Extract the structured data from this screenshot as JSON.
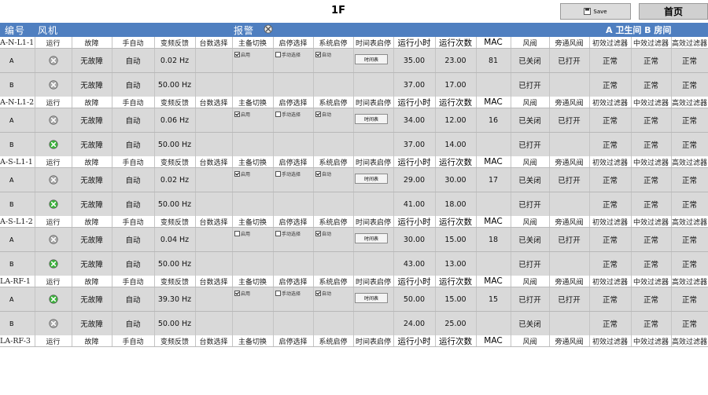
{
  "app": {
    "floor_title": "1F",
    "save_label": "Save",
    "home_label": "首页"
  },
  "header": {
    "number_label": "编号",
    "fan_label": "风机",
    "alarm_label": "报警",
    "room_label": "A 卫生间 B 房间"
  },
  "columns": {
    "run": "运行",
    "fault": "故障",
    "mode": "手自动",
    "freq": "变频反馈",
    "count_select": "台数选择",
    "standby_switch": "主备切换",
    "start_select": "启停选择",
    "system_start": "系统启停",
    "schedule": "时间表启停",
    "run_hours": "运行小时",
    "run_count": "运行次数",
    "mac": "MAC",
    "damper": "风阀",
    "bypass_damper": "旁通风阀",
    "primary_filter": "初效过滤器",
    "medium_filter": "中效过滤器",
    "hepa_filter": "高效过滤器"
  },
  "check": {
    "enable": "启用",
    "manual": "手动选择",
    "auto": "自动"
  },
  "icons": {
    "run_on_color": "#3bb53b",
    "run_off_color": "#a8a8a8",
    "alarm_icon": "gear-alarm-icon"
  },
  "units": [
    {
      "id": "A-N-L1-1",
      "mac": "81",
      "schedule_btn": "时间表",
      "rows": [
        {
          "label": "A",
          "running": false,
          "fault": "无故障",
          "mode": "自动",
          "freq": "0.02 Hz",
          "hours": "35.00",
          "count": "23.00",
          "damper": "已关闭",
          "bypass": "已打开",
          "f1": "正常",
          "f2": "正常",
          "f3": "正常",
          "check_standby": true
        },
        {
          "label": "B",
          "running": false,
          "fault": "无故障",
          "mode": "自动",
          "freq": "50.00 Hz",
          "hours": "37.00",
          "count": "17.00",
          "damper": "已打开",
          "bypass": "",
          "f1": "正常",
          "f2": "正常",
          "f3": "正常",
          "check_standby": false
        }
      ]
    },
    {
      "id": "A-N-L1-2",
      "mac": "16",
      "schedule_btn": "时间表",
      "rows": [
        {
          "label": "A",
          "running": false,
          "fault": "无故障",
          "mode": "自动",
          "freq": "0.06 Hz",
          "hours": "34.00",
          "count": "12.00",
          "damper": "已关闭",
          "bypass": "已打开",
          "f1": "正常",
          "f2": "正常",
          "f3": "正常",
          "check_standby": true
        },
        {
          "label": "B",
          "running": true,
          "fault": "无故障",
          "mode": "自动",
          "freq": "50.00 Hz",
          "hours": "37.00",
          "count": "14.00",
          "damper": "已打开",
          "bypass": "",
          "f1": "正常",
          "f2": "正常",
          "f3": "正常",
          "check_standby": false
        }
      ]
    },
    {
      "id": "A-S-L1-1",
      "mac": "17",
      "schedule_btn": "时间表",
      "rows": [
        {
          "label": "A",
          "running": false,
          "fault": "无故障",
          "mode": "自动",
          "freq": "0.02 Hz",
          "hours": "29.00",
          "count": "30.00",
          "damper": "已关闭",
          "bypass": "已打开",
          "f1": "正常",
          "f2": "正常",
          "f3": "正常",
          "check_standby": true
        },
        {
          "label": "B",
          "running": true,
          "fault": "无故障",
          "mode": "自动",
          "freq": "50.00 Hz",
          "hours": "41.00",
          "count": "18.00",
          "damper": "已打开",
          "bypass": "",
          "f1": "正常",
          "f2": "正常",
          "f3": "正常",
          "check_standby": false
        }
      ]
    },
    {
      "id": "A-S-L1-2",
      "mac": "18",
      "schedule_btn": "时间表",
      "rows": [
        {
          "label": "A",
          "running": false,
          "fault": "无故障",
          "mode": "自动",
          "freq": "0.04 Hz",
          "hours": "30.00",
          "count": "15.00",
          "damper": "已关闭",
          "bypass": "已打开",
          "f1": "正常",
          "f2": "正常",
          "f3": "正常",
          "check_standby": false
        },
        {
          "label": "B",
          "running": true,
          "fault": "无故障",
          "mode": "自动",
          "freq": "50.00 Hz",
          "hours": "43.00",
          "count": "13.00",
          "damper": "已打开",
          "bypass": "",
          "f1": "正常",
          "f2": "正常",
          "f3": "正常",
          "check_standby": false
        }
      ]
    },
    {
      "id": "LA-RF-1",
      "mac": "15",
      "schedule_btn": "时间表",
      "rows": [
        {
          "label": "A",
          "running": true,
          "fault": "无故障",
          "mode": "自动",
          "freq": "39.30 Hz",
          "hours": "50.00",
          "count": "15.00",
          "damper": "已打开",
          "bypass": "已打开",
          "f1": "正常",
          "f2": "正常",
          "f3": "正常",
          "check_standby": true
        },
        {
          "label": "B",
          "running": false,
          "fault": "无故障",
          "mode": "自动",
          "freq": "50.00 Hz",
          "hours": "24.00",
          "count": "25.00",
          "damper": "已关闭",
          "bypass": "",
          "f1": "正常",
          "f2": "正常",
          "f3": "正常",
          "check_standby": false
        }
      ]
    },
    {
      "id": "LA-RF-3",
      "mac": "",
      "schedule_btn": "时间表",
      "rows": []
    }
  ]
}
